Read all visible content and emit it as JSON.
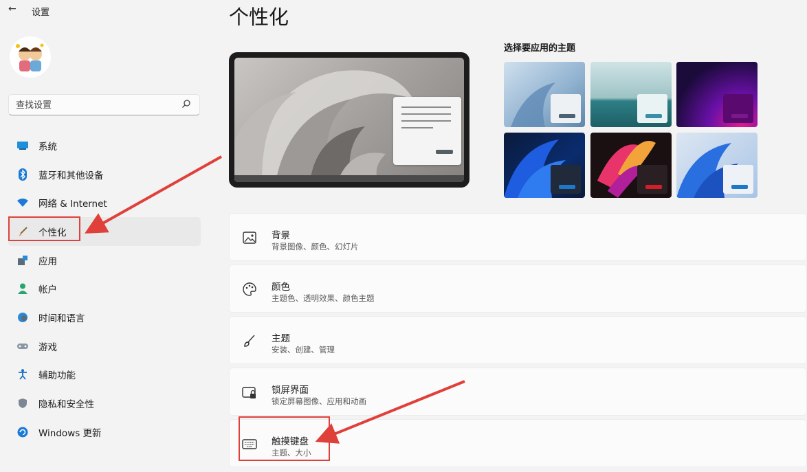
{
  "app": {
    "title": "设置"
  },
  "search": {
    "placeholder": "查找设置"
  },
  "nav": {
    "items": [
      {
        "label": "系统",
        "icon": "monitor-icon"
      },
      {
        "label": "蓝牙和其他设备",
        "icon": "bluetooth-icon"
      },
      {
        "label": "网络 & Internet",
        "icon": "wifi-icon"
      },
      {
        "label": "个性化",
        "icon": "brush-icon",
        "active": true
      },
      {
        "label": "应用",
        "icon": "apps-icon"
      },
      {
        "label": "帐户",
        "icon": "person-icon"
      },
      {
        "label": "时间和语言",
        "icon": "globe-clock-icon"
      },
      {
        "label": "游戏",
        "icon": "gamepad-icon"
      },
      {
        "label": "辅助功能",
        "icon": "accessibility-icon"
      },
      {
        "label": "隐私和安全性",
        "icon": "shield-icon"
      },
      {
        "label": "Windows 更新",
        "icon": "update-icon"
      }
    ]
  },
  "main": {
    "title": "个性化",
    "themes_label": "选择要应用的主题",
    "themes": [
      {
        "name": "light-bloom",
        "accent": "#4b6275"
      },
      {
        "name": "lake",
        "accent": "#3a8fa8"
      },
      {
        "name": "purple-glow",
        "accent": "#7a1a8a"
      },
      {
        "name": "dark-bloom",
        "accent": "#1e78c8"
      },
      {
        "name": "flow",
        "accent": "#d01f2a"
      },
      {
        "name": "blue-bloom",
        "accent": "#1e78c8"
      }
    ],
    "cards": [
      {
        "title": "背景",
        "subtitle": "背景图像、颜色、幻灯片",
        "icon": "image-icon"
      },
      {
        "title": "颜色",
        "subtitle": "主题色、透明效果、颜色主题",
        "icon": "palette-icon"
      },
      {
        "title": "主题",
        "subtitle": "安装、创建、管理",
        "icon": "brush-icon"
      },
      {
        "title": "锁屏界面",
        "subtitle": "锁定屏幕图像、应用和动画",
        "icon": "lock-screen-icon"
      },
      {
        "title": "触摸键盘",
        "subtitle": "主题、大小",
        "icon": "keyboard-icon"
      }
    ]
  },
  "colors": {
    "callout": "#e0403a",
    "accent": "#0067c0"
  }
}
